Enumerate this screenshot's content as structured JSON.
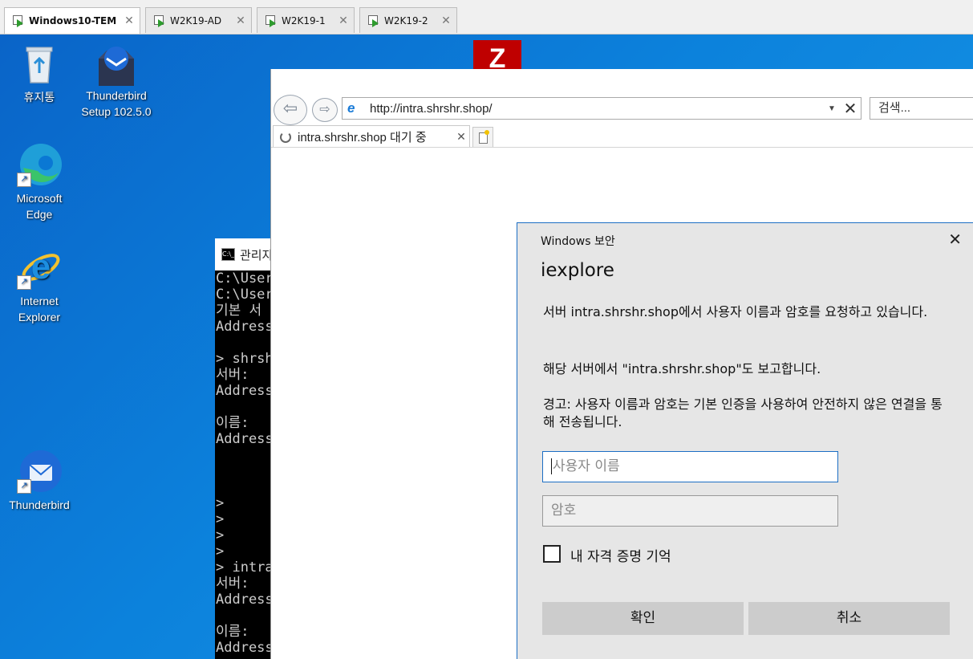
{
  "vm_tabs": [
    {
      "label": "Windows10-TEM",
      "active": true
    },
    {
      "label": "W2K19-AD",
      "active": false
    },
    {
      "label": "W2K19-1",
      "active": false
    },
    {
      "label": "W2K19-2",
      "active": false
    }
  ],
  "desktop_icons": [
    {
      "label": "휴지통",
      "icon": "recycle-bin-icon"
    },
    {
      "label": "Thunderbird Setup 102.5.0",
      "icon": "thunderbird-setup-icon"
    },
    {
      "label": "Microsoft Edge",
      "icon": "edge-icon"
    },
    {
      "label": "Internet Explorer",
      "icon": "internet-explorer-icon"
    },
    {
      "label": "Thunderbird",
      "icon": "thunderbird-icon"
    }
  ],
  "filezilla_icon_letter": "Z",
  "cmd": {
    "title": "관리자",
    "icon_text": "C:\\_",
    "lines": [
      "C:\\User",
      "C:\\User",
      "기본 서",
      "Address",
      "",
      "> shrsh",
      "서버:",
      "Address",
      "",
      "이름:",
      "Address",
      "",
      "",
      "",
      ">",
      ">",
      ">",
      ">",
      "> intra",
      "서버:",
      "Address",
      "",
      "이름:",
      "Address"
    ]
  },
  "ie": {
    "url": "http://intra.shrshr.shop/",
    "search_placeholder": "검색...",
    "tab_title": "intra.shrshr.shop 대기 중",
    "back_glyph": "⇦",
    "forward_glyph": "⇨"
  },
  "dialog": {
    "caption": "Windows 보안",
    "app_name": "iexplore",
    "message1": "서버 intra.shrshr.shop에서 사용자 이름과 암호를 요청하고 있습니다.",
    "message2": "해당 서버에서 \"intra.shrshr.shop\"도 보고합니다.",
    "message3": "경고: 사용자 이름과 암호는 기본 인증을 사용하여 안전하지 않은 연결을 통해 전송됩니다.",
    "username_placeholder": "사용자 이름",
    "password_placeholder": "암호",
    "remember_label": "내 자격 증명 기억",
    "remember_checked": false,
    "ok_label": "확인",
    "cancel_label": "취소"
  }
}
